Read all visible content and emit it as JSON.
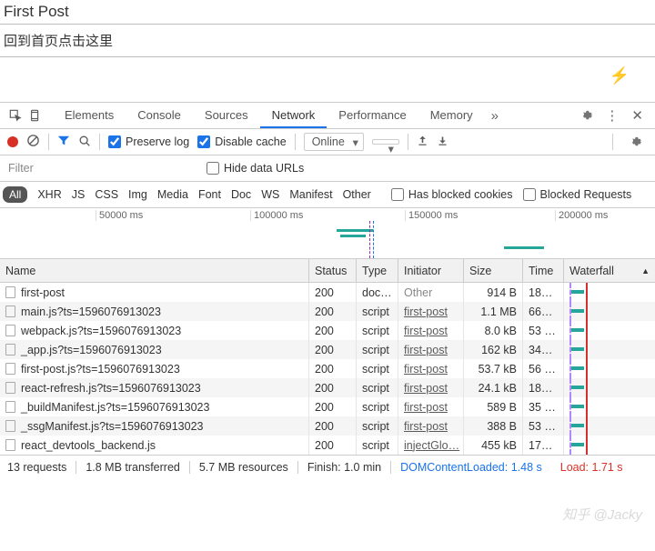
{
  "page": {
    "title": "First Post",
    "back_link": "回到首页点击这里"
  },
  "devtools": {
    "tabs": [
      "Elements",
      "Console",
      "Sources",
      "Network",
      "Performance",
      "Memory"
    ],
    "active_tab": 3,
    "toolbar": {
      "preserve_log": "Preserve log",
      "disable_cache": "Disable cache",
      "throttle": "Online"
    },
    "filter": {
      "placeholder": "Filter",
      "hide_data_urls": "Hide data URLs"
    },
    "types": {
      "all": "All",
      "items": [
        "XHR",
        "JS",
        "CSS",
        "Img",
        "Media",
        "Font",
        "Doc",
        "WS",
        "Manifest",
        "Other"
      ],
      "has_blocked": "Has blocked cookies",
      "blocked_req": "Blocked Requests"
    },
    "timeline_ticks": [
      "50000 ms",
      "100000 ms",
      "150000 ms",
      "200000 ms"
    ],
    "columns": {
      "name": "Name",
      "status": "Status",
      "type": "Type",
      "initiator": "Initiator",
      "size": "Size",
      "time": "Time",
      "waterfall": "Waterfall"
    },
    "rows": [
      {
        "name": "first-post",
        "status": "200",
        "type": "doc…",
        "initiator": "Other",
        "init_muted": true,
        "size": "914 B",
        "time": "18…"
      },
      {
        "name": "main.js?ts=1596076913023",
        "status": "200",
        "type": "script",
        "initiator": "first-post",
        "size": "1.1 MB",
        "time": "66…"
      },
      {
        "name": "webpack.js?ts=1596076913023",
        "status": "200",
        "type": "script",
        "initiator": "first-post",
        "size": "8.0 kB",
        "time": "53 …"
      },
      {
        "name": "_app.js?ts=1596076913023",
        "status": "200",
        "type": "script",
        "initiator": "first-post",
        "size": "162 kB",
        "time": "34…"
      },
      {
        "name": "first-post.js?ts=1596076913023",
        "status": "200",
        "type": "script",
        "initiator": "first-post",
        "size": "53.7 kB",
        "time": "56 …"
      },
      {
        "name": "react-refresh.js?ts=1596076913023",
        "status": "200",
        "type": "script",
        "initiator": "first-post",
        "size": "24.1 kB",
        "time": "18…"
      },
      {
        "name": "_buildManifest.js?ts=1596076913023",
        "status": "200",
        "type": "script",
        "initiator": "first-post",
        "size": "589 B",
        "time": "35 …"
      },
      {
        "name": "_ssgManifest.js?ts=1596076913023",
        "status": "200",
        "type": "script",
        "initiator": "first-post",
        "size": "388 B",
        "time": "53 …"
      },
      {
        "name": "react_devtools_backend.js",
        "status": "200",
        "type": "script",
        "initiator": "injectGlo…",
        "size": "455 kB",
        "time": "17…"
      }
    ],
    "status": {
      "requests": "13 requests",
      "transferred": "1.8 MB transferred",
      "resources": "5.7 MB resources",
      "finish": "Finish: 1.0 min",
      "dcl": "DOMContentLoaded: 1.48 s",
      "load": "Load: 1.71 s"
    }
  },
  "watermark": "知乎 @Jacky"
}
